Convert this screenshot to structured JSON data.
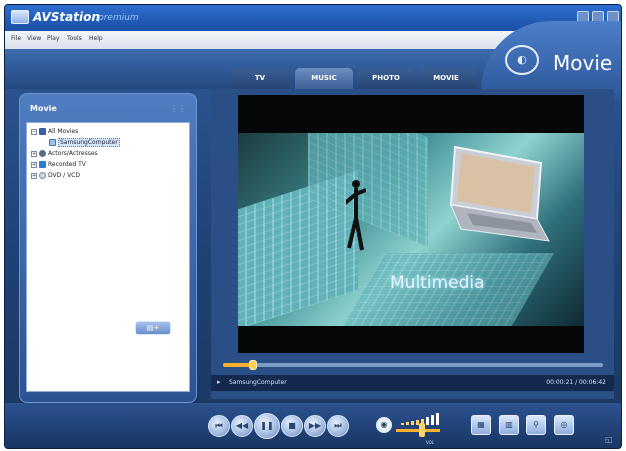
{
  "app": {
    "title": "AVStation",
    "edition": "premium",
    "mode": "Movie"
  },
  "menu": [
    "File",
    "View",
    "Play",
    "Tools",
    "Help"
  ],
  "tabs": [
    {
      "label": "TV",
      "active": false
    },
    {
      "label": "MUSIC",
      "active": true
    },
    {
      "label": "PHOTO",
      "active": false
    },
    {
      "label": "MOVIE",
      "active": false
    }
  ],
  "left_panel": {
    "title": "Movie",
    "tree": [
      {
        "label": "All Movies",
        "icon": "film-icon",
        "expander": "−"
      },
      {
        "label": "SamsungComputer",
        "icon": "video-file-icon",
        "selected": true
      },
      {
        "label": "Actors/Actresses",
        "icon": "person-icon",
        "expander": "+"
      },
      {
        "label": "Recorded TV",
        "icon": "tv-icon",
        "expander": "+"
      },
      {
        "label": "DVD / VCD",
        "icon": "disc-icon",
        "expander": "+"
      }
    ],
    "add_button": "+"
  },
  "player": {
    "caption": "Multimedia",
    "progress": 0.08,
    "now_playing": "SamsungComputer",
    "time": "00:00:21 / 00:06:42"
  },
  "controls": {
    "buttons": [
      "previous-icon",
      "rewind-icon",
      "pause-icon",
      "stop-icon",
      "fast-forward-icon",
      "next-icon"
    ],
    "volume_label": "VOL",
    "volume_level": 0.5,
    "tools": [
      "playlist-icon",
      "chapters-icon",
      "zoom-icon",
      "snapshot-icon"
    ]
  },
  "colors": {
    "accent": "#ffb12b",
    "window": "#1f4073",
    "titlebar": "#2e6ed0"
  }
}
